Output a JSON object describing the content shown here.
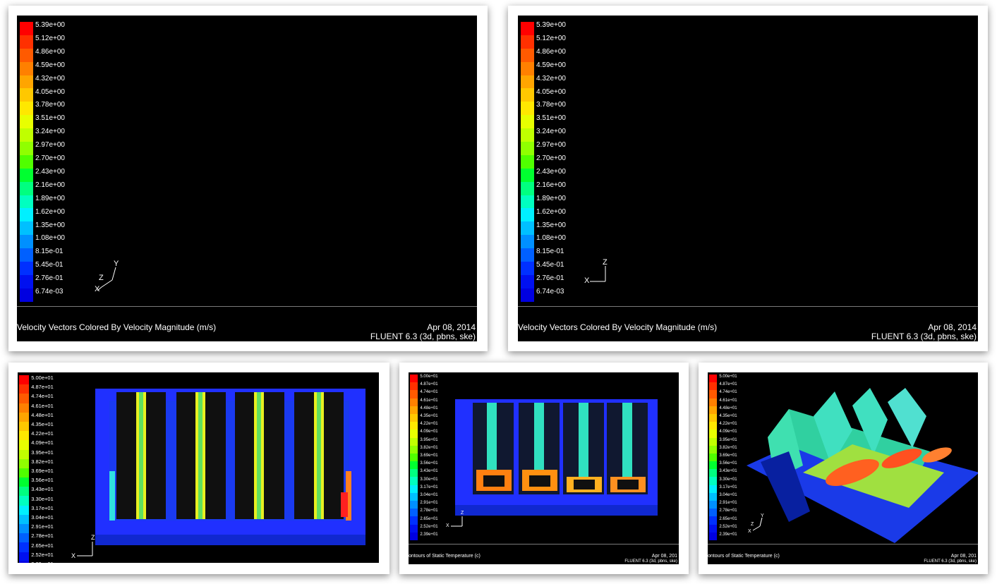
{
  "velocity_scale": [
    "5.39e+00",
    "5.12e+00",
    "4.86e+00",
    "4.59e+00",
    "4.32e+00",
    "4.05e+00",
    "3.78e+00",
    "3.51e+00",
    "3.24e+00",
    "2.97e+00",
    "2.70e+00",
    "2.43e+00",
    "2.16e+00",
    "1.89e+00",
    "1.62e+00",
    "1.35e+00",
    "1.08e+00",
    "8.15e-01",
    "5.45e-01",
    "2.76e-01",
    "6.74e-03"
  ],
  "temperature_scale": [
    "5.00e+01",
    "4.87e+01",
    "4.74e+01",
    "4.61e+01",
    "4.48e+01",
    "4.35e+01",
    "4.22e+01",
    "4.09e+01",
    "3.95e+01",
    "3.82e+01",
    "3.69e+01",
    "3.56e+01",
    "3.43e+01",
    "3.30e+01",
    "3.17e+01",
    "3.04e+01",
    "2.91e+01",
    "2.78e+01",
    "2.65e+01",
    "2.52e+01",
    "2.39e+01"
  ],
  "colormap": [
    "#ff0000",
    "#ff3000",
    "#ff5a00",
    "#ff8000",
    "#ffa500",
    "#ffc800",
    "#ffe800",
    "#e8ff00",
    "#c0ff00",
    "#90ff00",
    "#50ff00",
    "#00ff30",
    "#00ff80",
    "#00ffc0",
    "#00f0ff",
    "#00c0ff",
    "#0090ff",
    "#0060ff",
    "#0030ff",
    "#0010f0",
    "#0000e0"
  ],
  "panels": {
    "top_left": {
      "caption": "Velocity Vectors Colored By Velocity Magnitude (m/s)",
      "date": "Apr 08, 2014",
      "version": "FLUENT 6.3 (3d, pbns, ske)",
      "axis": {
        "z": "Z",
        "y": "Y",
        "x": "X"
      }
    },
    "top_right": {
      "caption": "Velocity Vectors Colored By Velocity Magnitude (m/s)",
      "date": "Apr 08, 2014",
      "version": "FLUENT 6.3 (3d, pbns, ske)",
      "axis": {
        "z": "Z",
        "x": "X"
      }
    },
    "bottom_left": {
      "axis": {
        "z": "Z",
        "x": "X"
      }
    },
    "bottom_mid": {
      "caption": "ontours of Static Temperature (c)",
      "date": "Apr 08, 201",
      "version": "FLUENT 6.3 (3d, pbns, ske)",
      "axis": {
        "z": "Z",
        "x": "X"
      }
    },
    "bottom_right": {
      "caption": "ontours of Static Temperature (c)",
      "date": "Apr 08, 201",
      "version": "FLUENT 6.3 (3d, pbns, ske)",
      "axis": {
        "z": "Z",
        "y": "Y",
        "x": "X"
      }
    }
  }
}
